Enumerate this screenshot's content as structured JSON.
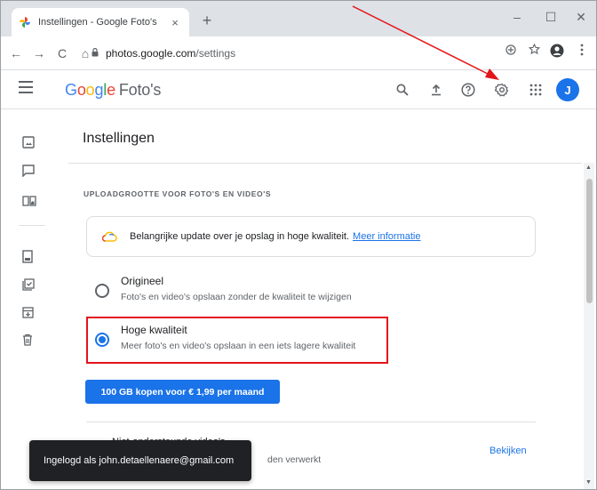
{
  "browser": {
    "tab_title": "Instellingen - Google Foto's",
    "tab_close": "×",
    "new_tab": "+",
    "win_minimize": "–",
    "win_maximize": "☐",
    "win_close": "✕",
    "nav_back": "←",
    "nav_forward": "→",
    "nav_reload": "C",
    "nav_home": "⌂",
    "url_host": "photos.google.com",
    "url_path": "/settings",
    "lock_glyph": "🔒"
  },
  "app": {
    "brand_letters": [
      "G",
      "o",
      "o",
      "g",
      "l",
      "e"
    ],
    "product": "Foto's",
    "avatar_initial": "J",
    "icons": [
      "search-icon",
      "upload-icon",
      "help-icon",
      "settings-icon",
      "apps-icon"
    ]
  },
  "page": {
    "title": "Instellingen",
    "upload_section_heading": "UPLOADGROOTTE VOOR FOTO'S EN VIDEO'S",
    "info_text": "Belangrijke update over je opslag in hoge kwaliteit.",
    "info_link": "Meer informatie",
    "options": [
      {
        "title": "Origineel",
        "subtitle": "Foto's en video's opslaan zonder de kwaliteit te wijzigen",
        "selected": false
      },
      {
        "title": "Hoge kwaliteit",
        "subtitle": "Meer foto's en video's opslaan in een iets lagere kwaliteit",
        "selected": true
      }
    ],
    "buy_button": "100 GB kopen voor € 1,99 per maand",
    "next_section_title": "Niet-ondersteunde video's",
    "next_section_sub": "den verwerkt",
    "view_link": "Bekijken"
  },
  "snackbar": {
    "text": "Ingelogd als john.detaellenaere@gmail.com"
  },
  "colors": {
    "accent": "#1a73e8",
    "highlight_box": "#e3141b",
    "annotation_arrow": "#e3141b"
  }
}
